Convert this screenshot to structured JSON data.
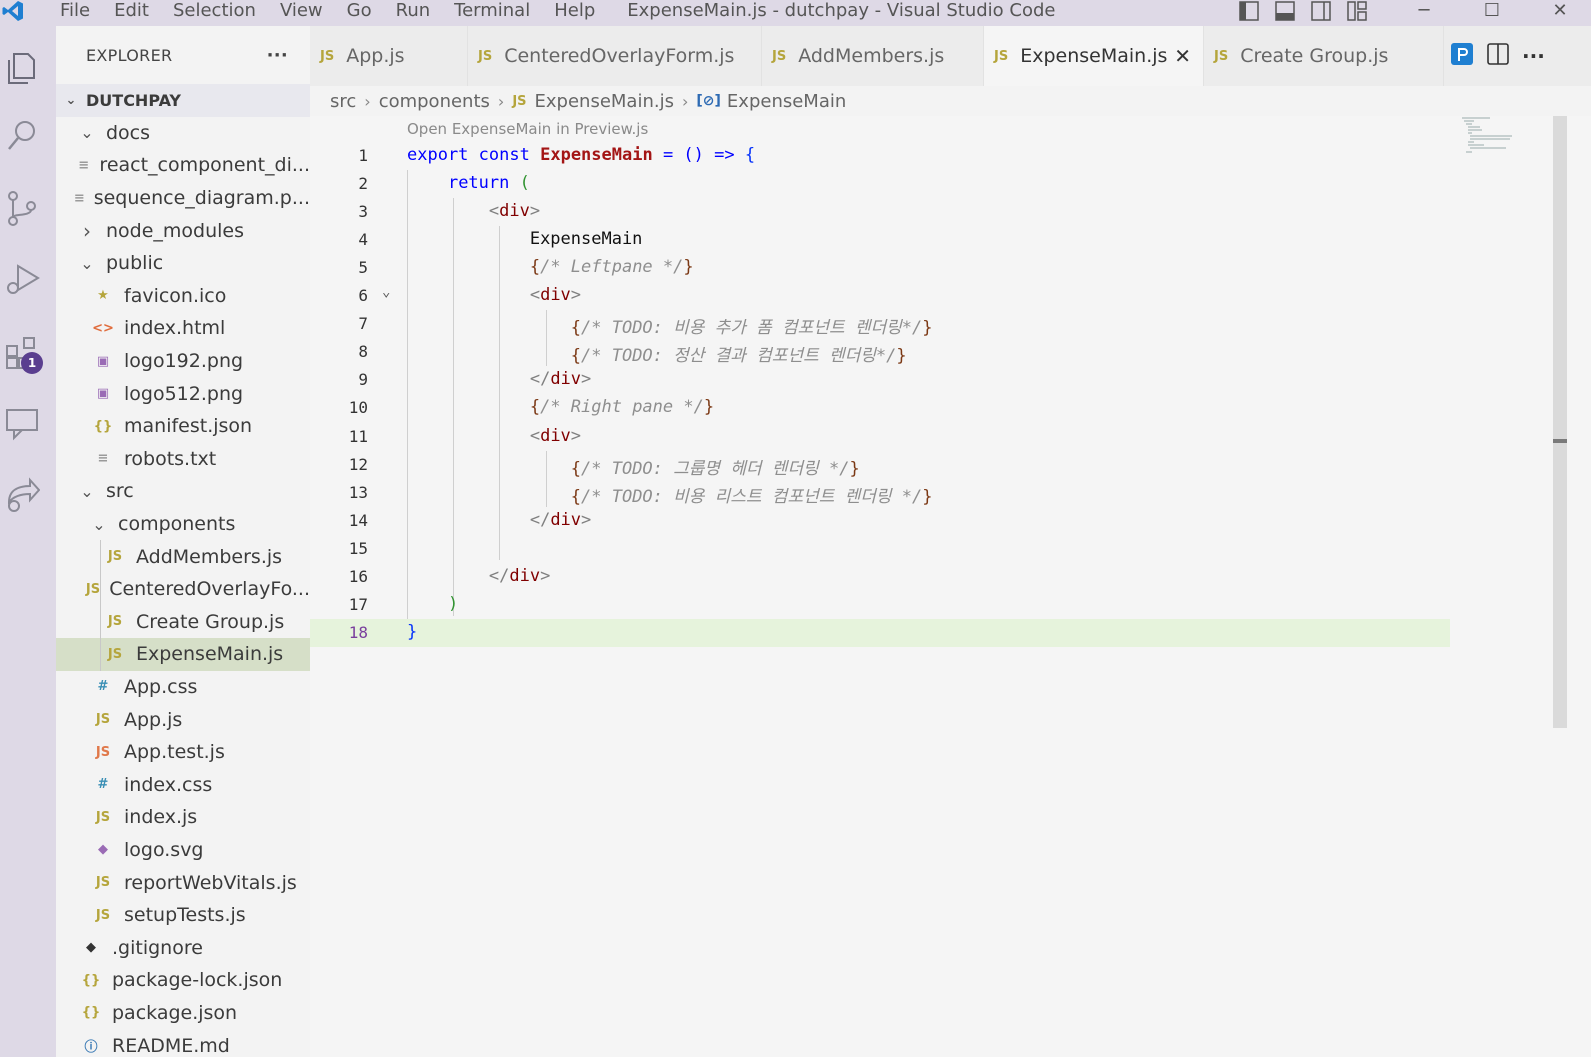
{
  "titlebar": {
    "menus": [
      "File",
      "Edit",
      "Selection",
      "View",
      "Go",
      "Run",
      "Terminal",
      "Help"
    ],
    "title": "ExpenseMain.js - dutchpay - Visual Studio Code",
    "controls": [
      "─",
      "☐",
      "✕"
    ]
  },
  "activitybar": {
    "icons": [
      "explorer-icon",
      "search-icon",
      "source-control-icon",
      "run-debug-icon",
      "extensions-icon",
      "remote-explorer-icon",
      "live-share-icon"
    ],
    "badge": "1"
  },
  "sidebar": {
    "header": "EXPLORER",
    "more": "···",
    "root": "DUTCHPAY",
    "items": [
      {
        "label": "docs",
        "type": "folder-open",
        "depth": 1
      },
      {
        "label": "react_component_di...",
        "type": "file-text",
        "depth": 2
      },
      {
        "label": "sequence_diagram.p...",
        "type": "file-text",
        "depth": 2
      },
      {
        "label": "node_modules",
        "type": "folder-closed",
        "depth": 1
      },
      {
        "label": "public",
        "type": "folder-open",
        "depth": 1
      },
      {
        "label": "favicon.ico",
        "type": "star",
        "depth": 2
      },
      {
        "label": "index.html",
        "type": "html",
        "depth": 2
      },
      {
        "label": "logo192.png",
        "type": "image",
        "depth": 2
      },
      {
        "label": "logo512.png",
        "type": "image",
        "depth": 2
      },
      {
        "label": "manifest.json",
        "type": "json",
        "depth": 2
      },
      {
        "label": "robots.txt",
        "type": "file-text",
        "depth": 2
      },
      {
        "label": "src",
        "type": "folder-open",
        "depth": 1
      },
      {
        "label": "components",
        "type": "folder-open",
        "depth": 2
      },
      {
        "label": "AddMembers.js",
        "type": "js",
        "depth": 3
      },
      {
        "label": "CenteredOverlayFo...",
        "type": "js",
        "depth": 3
      },
      {
        "label": "Create Group.js",
        "type": "js",
        "depth": 3
      },
      {
        "label": "ExpenseMain.js",
        "type": "js",
        "depth": 3,
        "selected": true
      },
      {
        "label": "App.css",
        "type": "css",
        "depth": 2
      },
      {
        "label": "App.js",
        "type": "js",
        "depth": 2
      },
      {
        "label": "App.test.js",
        "type": "jstest",
        "depth": 2
      },
      {
        "label": "index.css",
        "type": "css",
        "depth": 2
      },
      {
        "label": "index.js",
        "type": "js",
        "depth": 2
      },
      {
        "label": "logo.svg",
        "type": "svg",
        "depth": 2
      },
      {
        "label": "reportWebVitals.js",
        "type": "js",
        "depth": 2
      },
      {
        "label": "setupTests.js",
        "type": "js",
        "depth": 2
      },
      {
        "label": ".gitignore",
        "type": "git",
        "depth": 1
      },
      {
        "label": "package-lock.json",
        "type": "json",
        "depth": 1
      },
      {
        "label": "package.json",
        "type": "json",
        "depth": 1
      },
      {
        "label": "README.md",
        "type": "info",
        "depth": 1
      }
    ]
  },
  "tabs": [
    {
      "label": "App.js",
      "active": false
    },
    {
      "label": "CenteredOverlayForm.js",
      "active": false
    },
    {
      "label": "AddMembers.js",
      "active": false
    },
    {
      "label": "ExpenseMain.js",
      "active": true
    },
    {
      "label": "Create Group.js",
      "active": false
    }
  ],
  "tab_badge": "JS",
  "tab_close": "✕",
  "breadcrumb": {
    "parts": [
      "src",
      "components",
      "ExpenseMain.js",
      "ExpenseMain"
    ]
  },
  "editor": {
    "codelens": "Open ExpenseMain in Preview.js",
    "line_numbers": [
      "1",
      "2",
      "3",
      "4",
      "5",
      "6",
      "7",
      "8",
      "9",
      "10",
      "11",
      "12",
      "13",
      "14",
      "15",
      "16",
      "17",
      "18"
    ],
    "current_line": 18,
    "code": {
      "l1": {
        "kw": "export",
        "kw2": "const",
        "name": "ExpenseMain",
        "rest": "= () =>",
        "brace": "{"
      },
      "l2": {
        "kw": "return",
        "paren": "("
      },
      "l3": {
        "open": "<",
        "tag": "div",
        "close": ">"
      },
      "l4": {
        "text": "ExpenseMain"
      },
      "l5": {
        "ob": "{",
        "comment": "/* Leftpane */",
        "cb": "}"
      },
      "l6": {
        "open": "<",
        "tag": "div",
        "close": ">"
      },
      "l7": {
        "ob": "{",
        "comment": "/* TODO: 비용 추가 폼 컴포넌트 렌더링*/",
        "cb": "}"
      },
      "l8": {
        "ob": "{",
        "comment": "/* TODO: 정산 결과 컴포넌트 렌더링*/",
        "cb": "}"
      },
      "l9": {
        "open": "</",
        "tag": "div",
        "close": ">"
      },
      "l10": {
        "ob": "{",
        "comment": "/* Right pane */",
        "cb": "}"
      },
      "l11": {
        "open": "<",
        "tag": "div",
        "close": ">"
      },
      "l12": {
        "ob": "{",
        "comment": "/* TODO: 그룹명 헤더 렌더링 */",
        "cb": "}"
      },
      "l13": {
        "ob": "{",
        "comment": "/* TODO: 비용 리스트 컴포넌트 렌더링 */",
        "cb": "}"
      },
      "l14": {
        "open": "</",
        "tag": "div",
        "close": ">"
      },
      "l16": {
        "open": "</",
        "tag": "div",
        "close": ">"
      },
      "l17": {
        "paren": ")"
      },
      "l18": {
        "brace": "}"
      }
    }
  },
  "colors": {
    "titlebar_bg": "#ded9e6",
    "activitybar_bg": "#ded9e6",
    "selection_bg": "#d6dfc8",
    "current_line_bg": "#e6f3dc",
    "badge_bg": "#5a3e8f",
    "js_icon": "#b5a53c"
  }
}
